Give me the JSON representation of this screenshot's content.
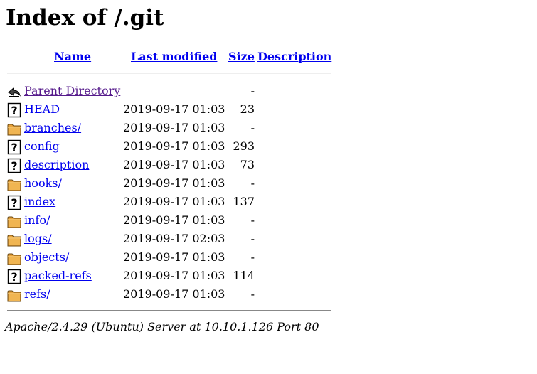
{
  "title": "Index of /.git",
  "columns": {
    "name": "Name",
    "last_modified": "Last modified",
    "size": "Size",
    "description": "Description"
  },
  "entries": [
    {
      "name": "Parent Directory",
      "modified": "",
      "size": "-",
      "icon": "back-arrow-icon",
      "visited": true
    },
    {
      "name": "HEAD",
      "modified": "2019-09-17 01:03",
      "size": "23",
      "icon": "unknown-file-icon"
    },
    {
      "name": "branches/",
      "modified": "2019-09-17 01:03",
      "size": "-",
      "icon": "folder-icon"
    },
    {
      "name": "config",
      "modified": "2019-09-17 01:03",
      "size": "293",
      "icon": "unknown-file-icon"
    },
    {
      "name": "description",
      "modified": "2019-09-17 01:03",
      "size": "73",
      "icon": "unknown-file-icon"
    },
    {
      "name": "hooks/",
      "modified": "2019-09-17 01:03",
      "size": "-",
      "icon": "folder-icon"
    },
    {
      "name": "index",
      "modified": "2019-09-17 01:03",
      "size": "137",
      "icon": "unknown-file-icon"
    },
    {
      "name": "info/",
      "modified": "2019-09-17 01:03",
      "size": "-",
      "icon": "folder-icon"
    },
    {
      "name": "logs/",
      "modified": "2019-09-17 02:03",
      "size": "-",
      "icon": "folder-icon"
    },
    {
      "name": "objects/",
      "modified": "2019-09-17 01:03",
      "size": "-",
      "icon": "folder-icon"
    },
    {
      "name": "packed-refs",
      "modified": "2019-09-17 01:03",
      "size": "114",
      "icon": "unknown-file-icon"
    },
    {
      "name": "refs/",
      "modified": "2019-09-17 01:03",
      "size": "-",
      "icon": "folder-icon"
    }
  ],
  "footer": "Apache/2.4.29 (Ubuntu) Server at 10.10.1.126 Port 80"
}
